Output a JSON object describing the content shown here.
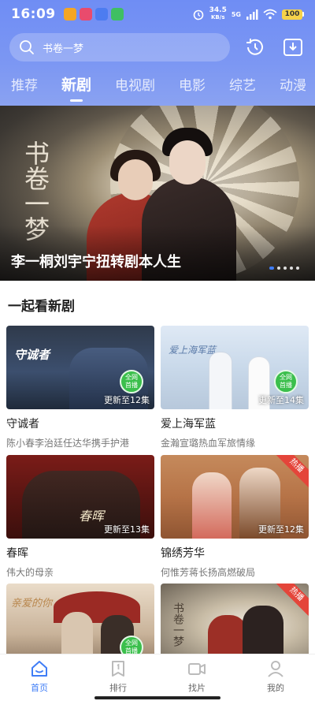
{
  "status": {
    "time": "16:09",
    "net_speed_value": "34.5",
    "net_speed_unit": "KB/s",
    "signal": "5G",
    "battery": "100"
  },
  "search": {
    "placeholder": "书卷一梦",
    "icon": "search-icon",
    "history_icon": "history-icon",
    "download_icon": "download-icon"
  },
  "tabs": [
    {
      "label": "推荐",
      "active": false
    },
    {
      "label": "新剧",
      "active": true
    },
    {
      "label": "电视剧",
      "active": false
    },
    {
      "label": "电影",
      "active": false
    },
    {
      "label": "综艺",
      "active": false
    },
    {
      "label": "动漫",
      "active": false
    }
  ],
  "banner": {
    "caption": "李一桐刘宇宁扭转剧本人生",
    "calligraphy": "书卷一梦"
  },
  "section": {
    "title": "一起看新剧"
  },
  "cards": [
    {
      "title": "守诚者",
      "subtitle": "陈小春李治廷任达华携手护港",
      "episode": "更新至12集",
      "badge": "全网首播",
      "thumb_text": "守诚者"
    },
    {
      "title": "爱上海军蓝",
      "subtitle": "金瀚宣璐热血军旅情缘",
      "episode": "更新至14集",
      "badge": "全网首播",
      "thumb_text": "爱上海军蓝"
    },
    {
      "title": "春晖",
      "subtitle": "伟大的母亲",
      "episode": "更新至13集",
      "thumb_text": "春晖"
    },
    {
      "title": "锦绣芳华",
      "subtitle": "何惟芳蒋长扬高燃破局",
      "episode": "更新至12集",
      "hot": "热播"
    },
    {
      "badge": "全网首播",
      "thumb_text": "亲爱的你"
    },
    {
      "hot": "热播",
      "thumb_text": "书卷一梦"
    }
  ],
  "bottom_nav": [
    {
      "label": "首页",
      "icon": "home-icon",
      "active": true
    },
    {
      "label": "排行",
      "icon": "ranking-icon",
      "active": false
    },
    {
      "label": "找片",
      "icon": "video-camera-icon",
      "active": false
    },
    {
      "label": "我的",
      "icon": "profile-icon",
      "active": false
    }
  ],
  "colors": {
    "accent": "#3f7df6",
    "header_gradient_start": "#6f8df4",
    "header_gradient_end": "#8aa2f1",
    "badge_green": "#3bbf4c",
    "hot_red": "#e4453a"
  }
}
